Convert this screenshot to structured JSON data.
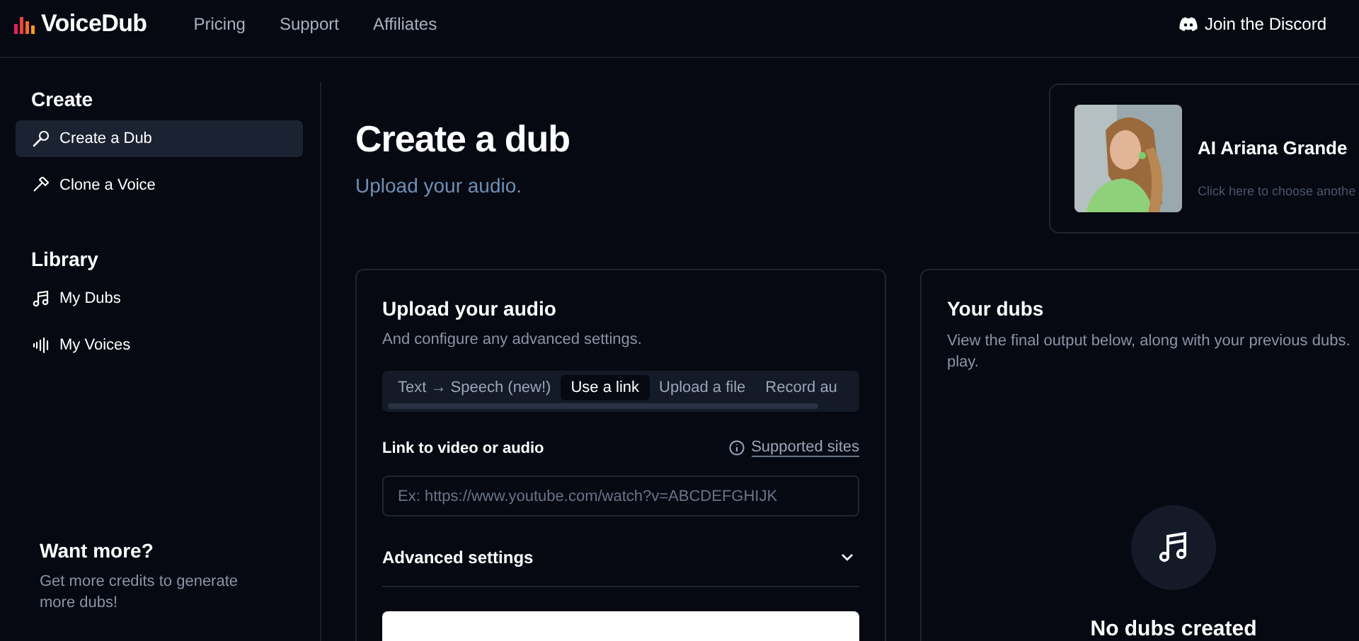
{
  "header": {
    "logo": "VoiceDub",
    "nav": [
      {
        "label": "Pricing"
      },
      {
        "label": "Support"
      },
      {
        "label": "Affiliates"
      }
    ],
    "discord": "Join the Discord"
  },
  "sidebar": {
    "sections": [
      {
        "title": "Create",
        "items": [
          {
            "label": "Create a Dub",
            "selected": true
          },
          {
            "label": "Clone a Voice",
            "selected": false
          }
        ]
      },
      {
        "title": "Library",
        "items": [
          {
            "label": "My Dubs",
            "selected": false
          },
          {
            "label": "My Voices",
            "selected": false
          }
        ]
      }
    ],
    "promo": {
      "title": "Want more?",
      "text": "Get more credits to generate more dubs!"
    }
  },
  "page": {
    "title": "Create a dub",
    "subtitle": "Upload your audio."
  },
  "voice_card": {
    "name": "AI Ariana Grande",
    "hint": "Click here to choose anothe"
  },
  "upload": {
    "title": "Upload your audio",
    "subtitle": "And configure any advanced settings.",
    "tabs": [
      {
        "label": "Text → Speech (new!)",
        "selected": false
      },
      {
        "label": "Use a link",
        "selected": true
      },
      {
        "label": "Upload a file",
        "selected": false
      },
      {
        "label": "Record au",
        "selected": false
      }
    ],
    "field_label": "Link to video or audio",
    "supported_link": "Supported sites",
    "placeholder": "Ex: https://www.youtube.com/watch?v=ABCDEFGHIJK",
    "advanced": {
      "label": "Advanced settings",
      "expanded": false
    }
  },
  "dubs": {
    "title": "Your dubs",
    "description": [
      "View the final output below, along with your previous dubs.",
      "play."
    ],
    "empty": "No dubs created"
  }
}
